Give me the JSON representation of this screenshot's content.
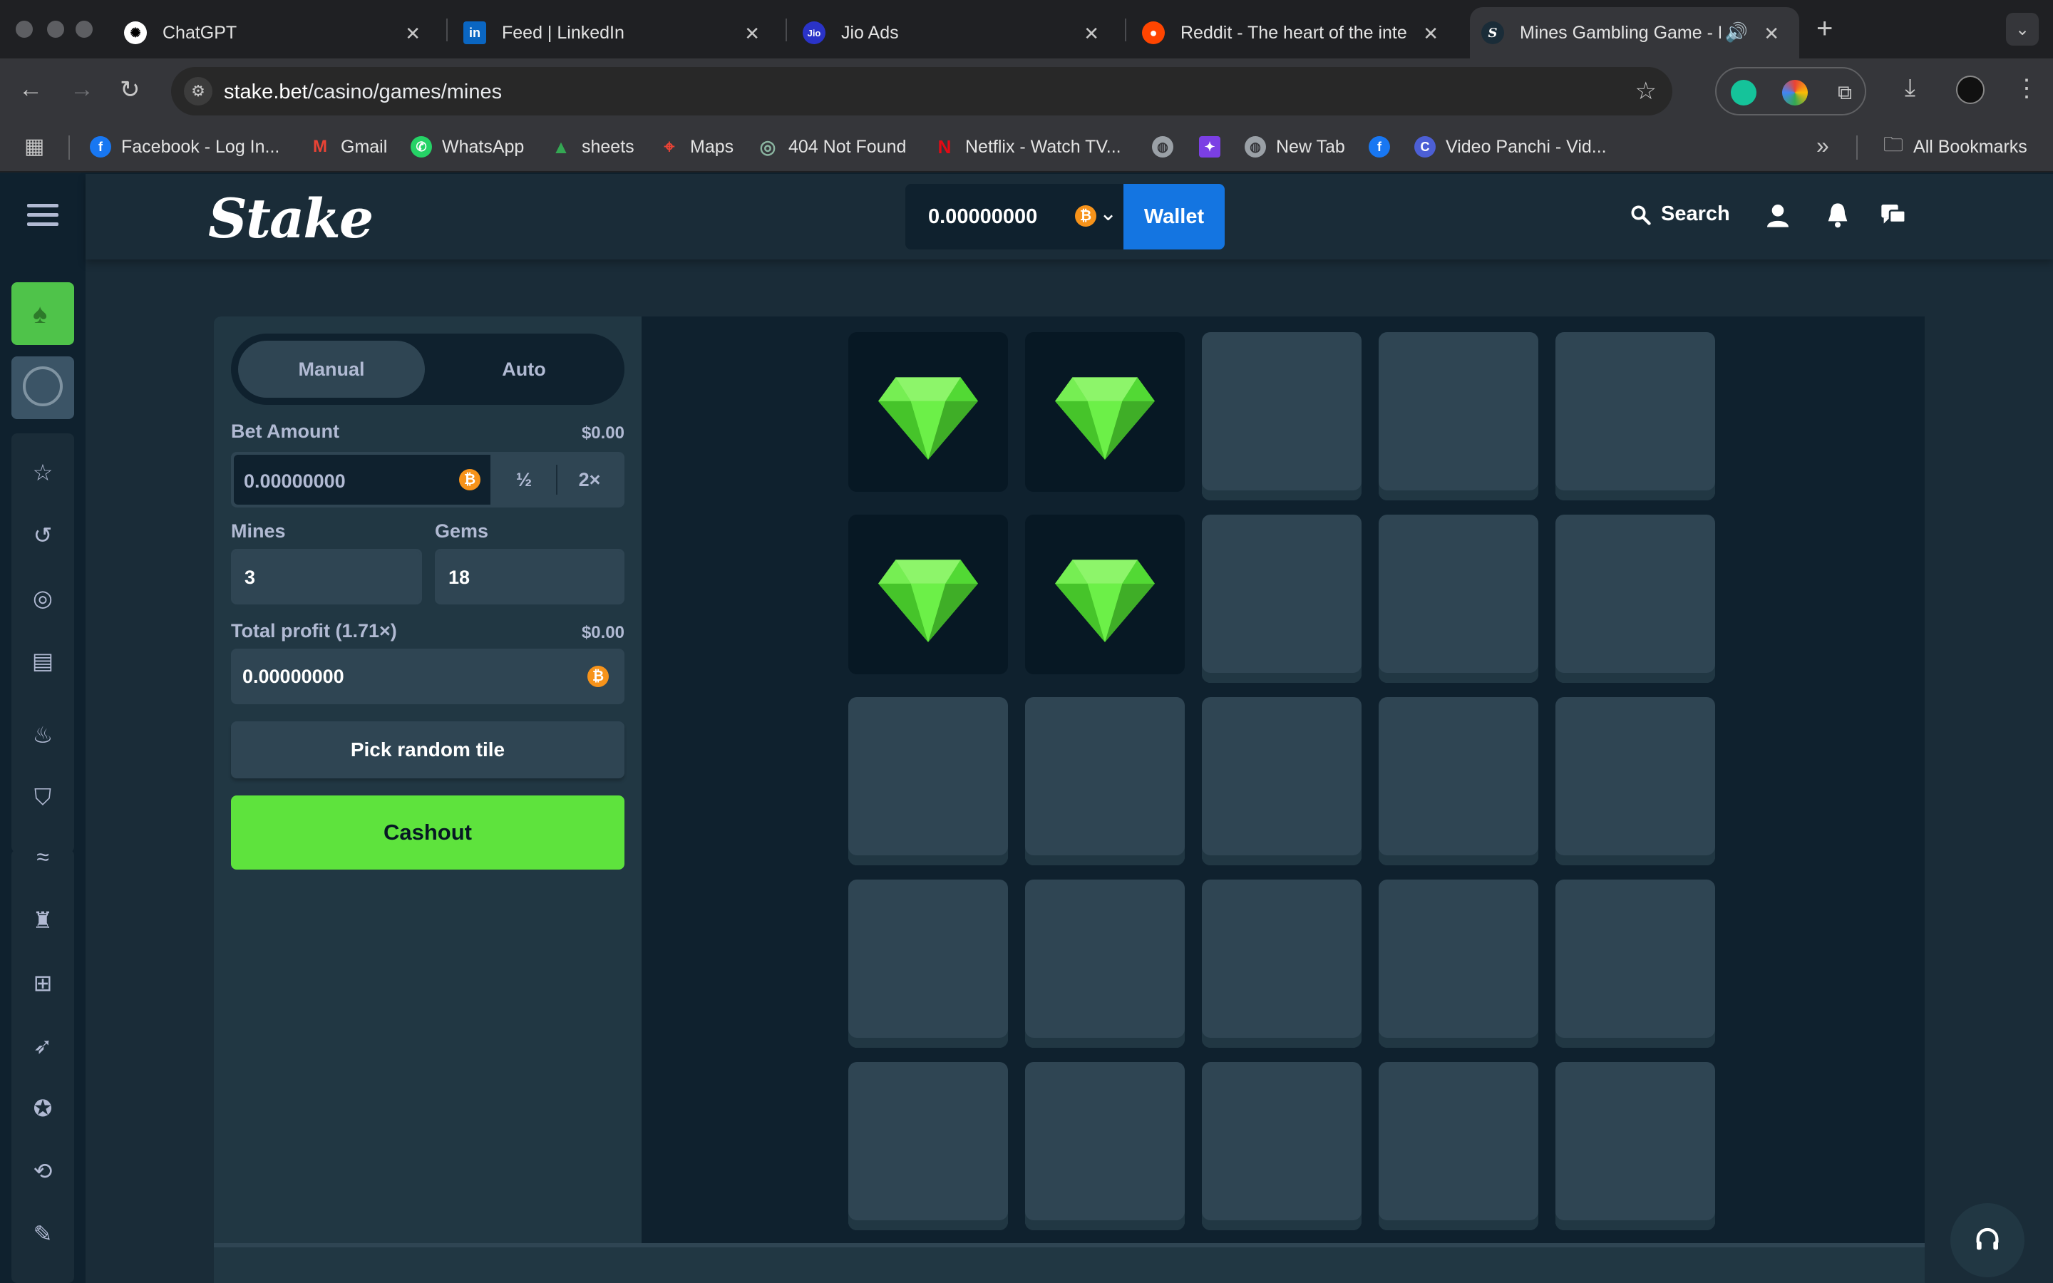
{
  "browser": {
    "tabs": [
      {
        "title": "ChatGPT",
        "icon": "chatgpt-icon",
        "color": "#ffffff"
      },
      {
        "title": "Feed | LinkedIn",
        "icon": "linkedin-icon",
        "color": "#0a66c2"
      },
      {
        "title": "Jio Ads",
        "icon": "jio-icon",
        "color": "#2a33c8"
      },
      {
        "title": "Reddit - The heart of the inte",
        "icon": "reddit-icon",
        "color": "#ff4500"
      },
      {
        "title": "Mines Gambling Game - P",
        "icon": "stake-icon",
        "color": "#ffffff"
      }
    ],
    "address": {
      "host": "stake.bet",
      "path": "/casino/games/mines"
    },
    "bookmarks": [
      {
        "label": "Facebook - Log In...",
        "icon": "facebook-icon",
        "color": "#1877f2"
      },
      {
        "label": "Gmail",
        "icon": "gmail-icon",
        "color": "#ea4335"
      },
      {
        "label": "WhatsApp",
        "icon": "whatsapp-icon",
        "color": "#25d366"
      },
      {
        "label": "sheets",
        "icon": "drive-icon",
        "color": "#34a853"
      },
      {
        "label": "Maps",
        "icon": "maps-icon",
        "color": "#ea4335"
      },
      {
        "label": "404 Not Found",
        "icon": "globe-icon",
        "color": "#8ab4a0"
      },
      {
        "label": "Netflix - Watch TV...",
        "icon": "netflix-icon",
        "color": "#e50914"
      },
      {
        "label": "",
        "icon": "globe-icon",
        "color": "#9aa0a6"
      },
      {
        "label": "",
        "icon": "app-icon",
        "color": "#7b3fe4"
      },
      {
        "label": "New Tab",
        "icon": "globe-icon",
        "color": "#9aa0a6"
      },
      {
        "label": "",
        "icon": "facebook-icon",
        "color": "#1877f2"
      },
      {
        "label": "Video Panchi - Vid...",
        "icon": "c-icon",
        "color": "#4c5fd5"
      }
    ],
    "all_bookmarks": "All Bookmarks",
    "more_bookmarks": "»"
  },
  "header": {
    "logo": "Stake",
    "balance": "0.00000000",
    "wallet_label": "Wallet",
    "search_label": "Search"
  },
  "game": {
    "mode_tabs": [
      "Manual",
      "Auto"
    ],
    "active_mode": "Manual",
    "bet_amount_label": "Bet Amount",
    "bet_amount_usd": "$0.00",
    "bet_amount_value": "0.00000000",
    "half_label": "½",
    "double_label": "2×",
    "mines_label": "Mines",
    "mines_value": "3",
    "gems_label": "Gems",
    "gems_value": "18",
    "total_profit_label": "Total profit (1.71×)",
    "total_profit_usd": "$0.00",
    "total_profit_value": "0.00000000",
    "pick_random_label": "Pick random tile",
    "cashout_label": "Cashout",
    "grid": {
      "rows": 5,
      "cols": 5,
      "revealed_gems": [
        [
          0,
          0
        ],
        [
          0,
          1
        ],
        [
          1,
          0
        ],
        [
          1,
          1
        ]
      ]
    }
  },
  "colors": {
    "accent_green": "#5ee33d",
    "wallet_blue": "#1475e1",
    "gem_green": "#5ee33d",
    "btc_orange": "#f7931a"
  }
}
